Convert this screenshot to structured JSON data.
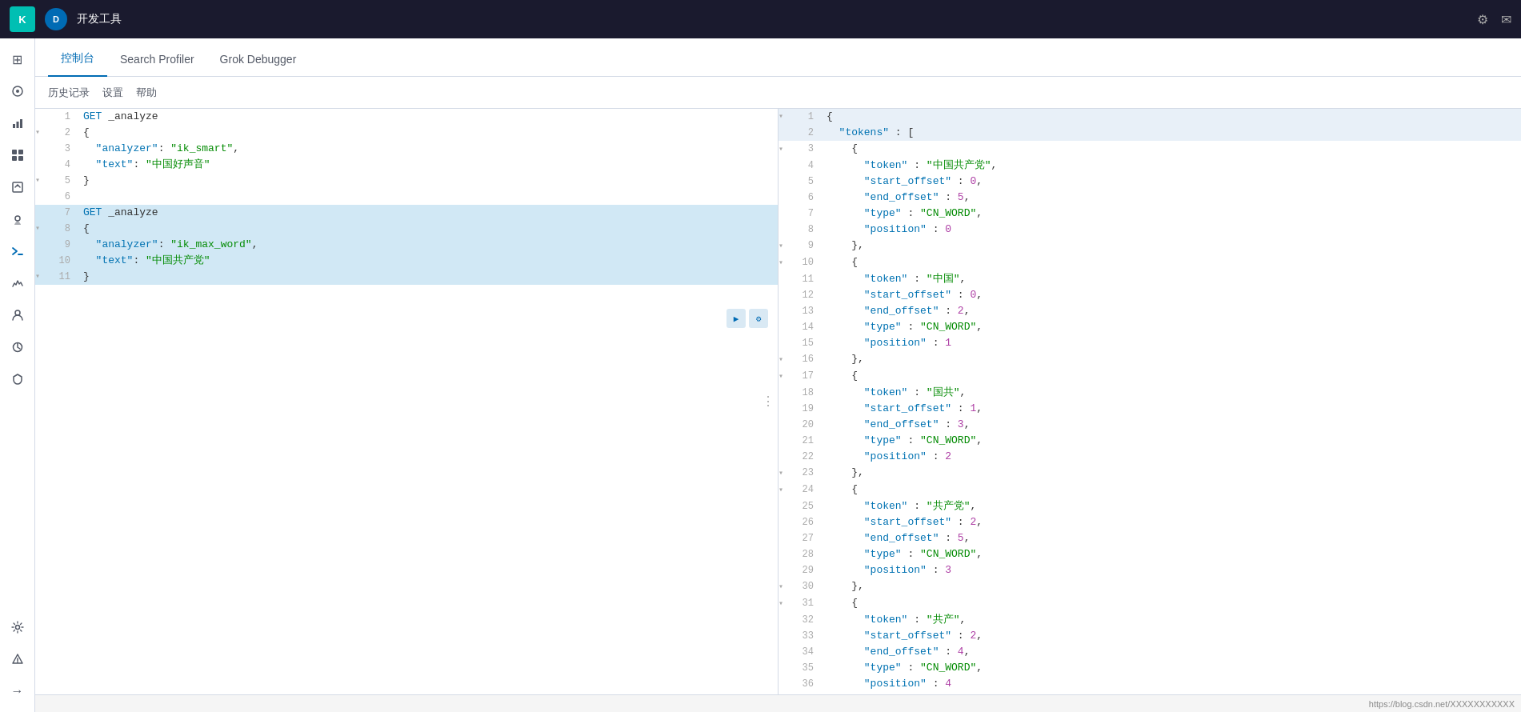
{
  "topbar": {
    "logo": "K",
    "avatar": "D",
    "title": "开发工具",
    "icon_settings": "⚙",
    "icon_mail": "✉"
  },
  "tabs": [
    {
      "id": "console",
      "label": "控制台",
      "active": true
    },
    {
      "id": "search-profiler",
      "label": "Search Profiler",
      "active": false
    },
    {
      "id": "grok-debugger",
      "label": "Grok Debugger",
      "active": false
    }
  ],
  "toolbar": {
    "history": "历史记录",
    "settings": "设置",
    "help": "帮助"
  },
  "left_code": [
    {
      "line": 1,
      "content": "GET _analyze",
      "highlight": false,
      "fold": false
    },
    {
      "line": 2,
      "content": "{",
      "highlight": false,
      "fold": true
    },
    {
      "line": 3,
      "content": "  \"analyzer\": \"ik_smart\",",
      "highlight": false,
      "fold": false
    },
    {
      "line": 4,
      "content": "  \"text\": \"中国好声音\"",
      "highlight": false,
      "fold": false
    },
    {
      "line": 5,
      "content": "}",
      "highlight": false,
      "fold": true
    },
    {
      "line": 6,
      "content": "",
      "highlight": false,
      "fold": false
    },
    {
      "line": 7,
      "content": "GET _analyze",
      "highlight": true,
      "fold": false
    },
    {
      "line": 8,
      "content": "{",
      "highlight": true,
      "fold": true
    },
    {
      "line": 9,
      "content": "  \"analyzer\": \"ik_max_word\",",
      "highlight": true,
      "fold": false
    },
    {
      "line": 10,
      "content": "  \"text\": \"中国共产党\"",
      "highlight": true,
      "fold": false
    },
    {
      "line": 11,
      "content": "}",
      "highlight": true,
      "fold": true
    }
  ],
  "right_code": [
    {
      "line": 1,
      "content": "{",
      "fold": true
    },
    {
      "line": 2,
      "content": "  \"tokens\" : [",
      "fold": false
    },
    {
      "line": 3,
      "content": "    {",
      "fold": true
    },
    {
      "line": 4,
      "content": "      \"token\" : \"中国共产党\",",
      "fold": false
    },
    {
      "line": 5,
      "content": "      \"start_offset\" : 0,",
      "fold": false
    },
    {
      "line": 6,
      "content": "      \"end_offset\" : 5,",
      "fold": false
    },
    {
      "line": 7,
      "content": "      \"type\" : \"CN_WORD\",",
      "fold": false
    },
    {
      "line": 8,
      "content": "      \"position\" : 0",
      "fold": false
    },
    {
      "line": 9,
      "content": "    },",
      "fold": true
    },
    {
      "line": 10,
      "content": "    {",
      "fold": true
    },
    {
      "line": 11,
      "content": "      \"token\" : \"中国\",",
      "fold": false
    },
    {
      "line": 12,
      "content": "      \"start_offset\" : 0,",
      "fold": false
    },
    {
      "line": 13,
      "content": "      \"end_offset\" : 2,",
      "fold": false
    },
    {
      "line": 14,
      "content": "      \"type\" : \"CN_WORD\",",
      "fold": false
    },
    {
      "line": 15,
      "content": "      \"position\" : 1",
      "fold": false
    },
    {
      "line": 16,
      "content": "    },",
      "fold": true
    },
    {
      "line": 17,
      "content": "    {",
      "fold": true
    },
    {
      "line": 18,
      "content": "      \"token\" : \"国共\",",
      "fold": false
    },
    {
      "line": 19,
      "content": "      \"start_offset\" : 1,",
      "fold": false
    },
    {
      "line": 20,
      "content": "      \"end_offset\" : 3,",
      "fold": false
    },
    {
      "line": 21,
      "content": "      \"type\" : \"CN_WORD\",",
      "fold": false
    },
    {
      "line": 22,
      "content": "      \"position\" : 2",
      "fold": false
    },
    {
      "line": 23,
      "content": "    },",
      "fold": true
    },
    {
      "line": 24,
      "content": "    {",
      "fold": true
    },
    {
      "line": 25,
      "content": "      \"token\" : \"共产党\",",
      "fold": false
    },
    {
      "line": 26,
      "content": "      \"start_offset\" : 2,",
      "fold": false
    },
    {
      "line": 27,
      "content": "      \"end_offset\" : 5,",
      "fold": false
    },
    {
      "line": 28,
      "content": "      \"type\" : \"CN_WORD\",",
      "fold": false
    },
    {
      "line": 29,
      "content": "      \"position\" : 3",
      "fold": false
    },
    {
      "line": 30,
      "content": "    },",
      "fold": true
    },
    {
      "line": 31,
      "content": "    {",
      "fold": true
    },
    {
      "line": 32,
      "content": "      \"token\" : \"共产\",",
      "fold": false
    },
    {
      "line": 33,
      "content": "      \"start_offset\" : 2,",
      "fold": false
    },
    {
      "line": 34,
      "content": "      \"end_offset\" : 4,",
      "fold": false
    },
    {
      "line": 35,
      "content": "      \"type\" : \"CN_WORD\",",
      "fold": false
    },
    {
      "line": 36,
      "content": "      \"position\" : 4",
      "fold": false
    }
  ],
  "sidebar_icons": [
    {
      "id": "home",
      "icon": "⊞",
      "active": false
    },
    {
      "id": "discover",
      "icon": "○",
      "active": false
    },
    {
      "id": "dashboard",
      "icon": "▦",
      "active": false
    },
    {
      "id": "canvas",
      "icon": "⬒",
      "active": false
    },
    {
      "id": "maps",
      "icon": "◈",
      "active": false
    },
    {
      "id": "devtools",
      "icon": "✦",
      "active": true
    },
    {
      "id": "monitoring",
      "icon": "♡",
      "active": false
    },
    {
      "id": "management",
      "icon": "⚙",
      "active": false
    },
    {
      "id": "alerts",
      "icon": "⚡",
      "active": false
    },
    {
      "id": "siem",
      "icon": "⧖",
      "active": false
    },
    {
      "id": "arrow",
      "icon": "→",
      "active": false
    }
  ],
  "status_bar": {
    "url": "https://blog.csdn.net/XXXXXXXXXXX"
  }
}
